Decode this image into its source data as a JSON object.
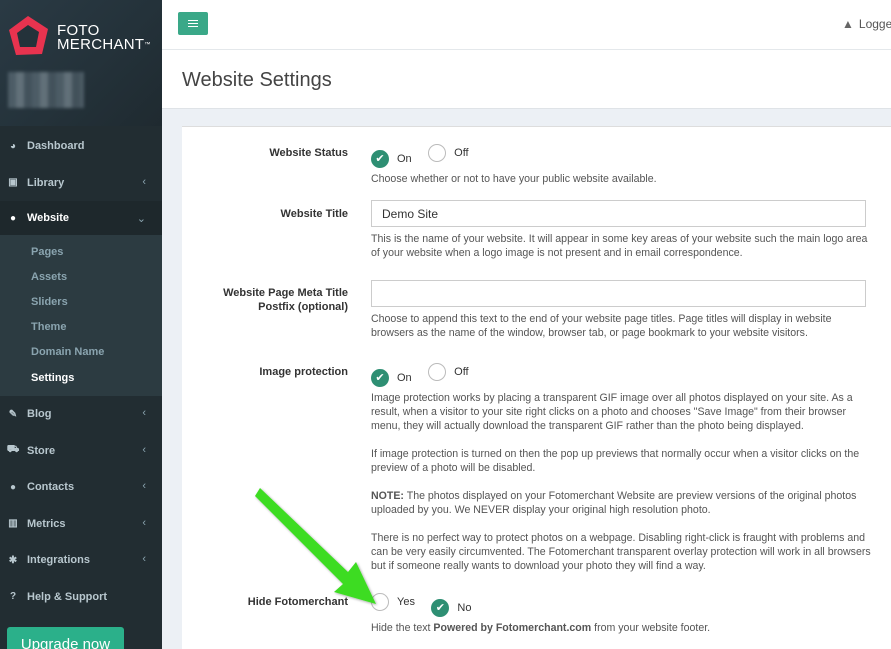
{
  "brand": {
    "line1": "FOTO",
    "line2": "MERCHANT",
    "tm": "™",
    "accent": "#e8334f"
  },
  "sidebar": {
    "items": [
      {
        "label": "Dashboard",
        "icon": "dashboard-icon"
      },
      {
        "label": "Library",
        "icon": "image-icon"
      },
      {
        "label": "Website",
        "icon": "globe-icon"
      },
      {
        "label": "Blog",
        "icon": "edit-icon"
      },
      {
        "label": "Store",
        "icon": "cart-icon"
      },
      {
        "label": "Contacts",
        "icon": "user-icon"
      },
      {
        "label": "Metrics",
        "icon": "bar-chart-icon"
      },
      {
        "label": "Integrations",
        "icon": "cog-icon"
      },
      {
        "label": "Help & Support",
        "icon": "question-icon"
      }
    ],
    "website_sub": [
      "Pages",
      "Assets",
      "Sliders",
      "Theme",
      "Domain Name",
      "Settings"
    ],
    "upgrade_label": "Upgrade now"
  },
  "topbar": {
    "logged": "Logge"
  },
  "page": {
    "title": "Website Settings"
  },
  "form": {
    "website_status": {
      "label": "Website Status",
      "on": "On",
      "off": "Off",
      "selected": "On",
      "help": "Choose whether or not to have your public website available."
    },
    "website_title": {
      "label": "Website Title",
      "value": "Demo Site",
      "help": "This is the name of your website. It will appear in some key areas of your website such the main logo area of your website when a logo image is not present and in email correspondence."
    },
    "meta_title": {
      "label1": "Website Page Meta Title",
      "label2": "Postfix (optional)",
      "value": "",
      "help": "Choose to append this text to the end of your website page titles. Page titles will display in website browsers as the name of the window, browser tab, or page bookmark to your website visitors."
    },
    "image_protection": {
      "label": "Image protection",
      "on": "On",
      "off": "Off",
      "selected": "On",
      "help1": "Image protection works by placing a transparent GIF image over all photos displayed on your site. As a result, when a visitor to your site right clicks on a photo and chooses \"Save Image\" from their browser menu, they will actually download the transparent GIF rather than the photo being displayed.",
      "help2": "If image protection is turned on then the pop up previews that normally occur when a visitor clicks on the preview of a photo will be disabled.",
      "note_label": "NOTE:",
      "help3": " The photos displayed on your Fotomerchant Website are preview versions of the original photos uploaded by you. We NEVER display your original high resolution photo.",
      "help4": "There is no perfect way to protect photos on a webpage. Disabling right-click is fraught with problems and can be very easily circumvented. The Fotomerchant transparent overlay protection will work in all browsers but if someone really wants to download your photo they will find a way."
    },
    "hide_fotomerchant": {
      "label": "Hide Fotomerchant",
      "yes": "Yes",
      "no": "No",
      "selected": "No",
      "help_pre": "Hide the text ",
      "help_bold": "Powered by Fotomerchant.com",
      "help_post": " from your website footer."
    }
  },
  "colors": {
    "sidebar": "#222d32",
    "accent_green": "#2e8f73",
    "annotation_arrow": "#3ddc22"
  }
}
